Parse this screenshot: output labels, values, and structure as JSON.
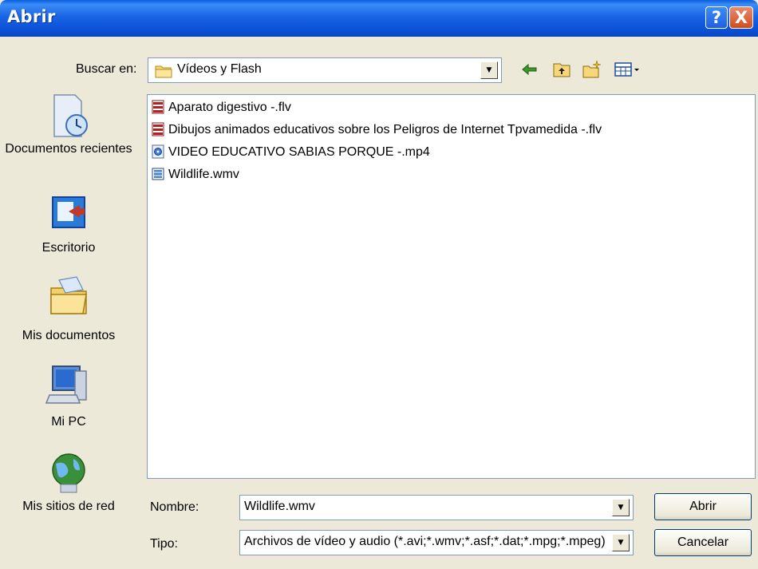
{
  "window": {
    "title": "Abrir",
    "help_label": "?",
    "close_label": "X"
  },
  "lookin": {
    "label": "Buscar en:",
    "value": "Vídeos y Flash"
  },
  "places": [
    {
      "label": "Documentos recientes"
    },
    {
      "label": "Escritorio"
    },
    {
      "label": "Mis documentos"
    },
    {
      "label": "Mi PC"
    },
    {
      "label": "Mis sitios de red"
    }
  ],
  "files": [
    {
      "name": "Aparato digestivo -.flv",
      "icon": "flv-file-icon"
    },
    {
      "name": "Dibujos animados educativos sobre los Peligros de Internet Tpvamedida -.flv",
      "icon": "flv-file-icon"
    },
    {
      "name": "VIDEO EDUCATIVO SABIAS PORQUE -.mp4",
      "icon": "mp4-file-icon"
    },
    {
      "name": "Wildlife.wmv",
      "icon": "wmv-file-icon"
    }
  ],
  "filename": {
    "label": "Nombre:",
    "value": "Wildlife.wmv"
  },
  "filetype": {
    "label": "Tipo:",
    "value": "Archivos de vídeo y audio (*.avi;*.wmv;*.asf;*.dat;*.mpg;*.mpeg)"
  },
  "buttons": {
    "open": "Abrir",
    "cancel": "Cancelar"
  },
  "colors": {
    "titlebar": "#0b52d6",
    "dialog_bg": "#ece9d8",
    "field_border": "#7f9db9"
  }
}
